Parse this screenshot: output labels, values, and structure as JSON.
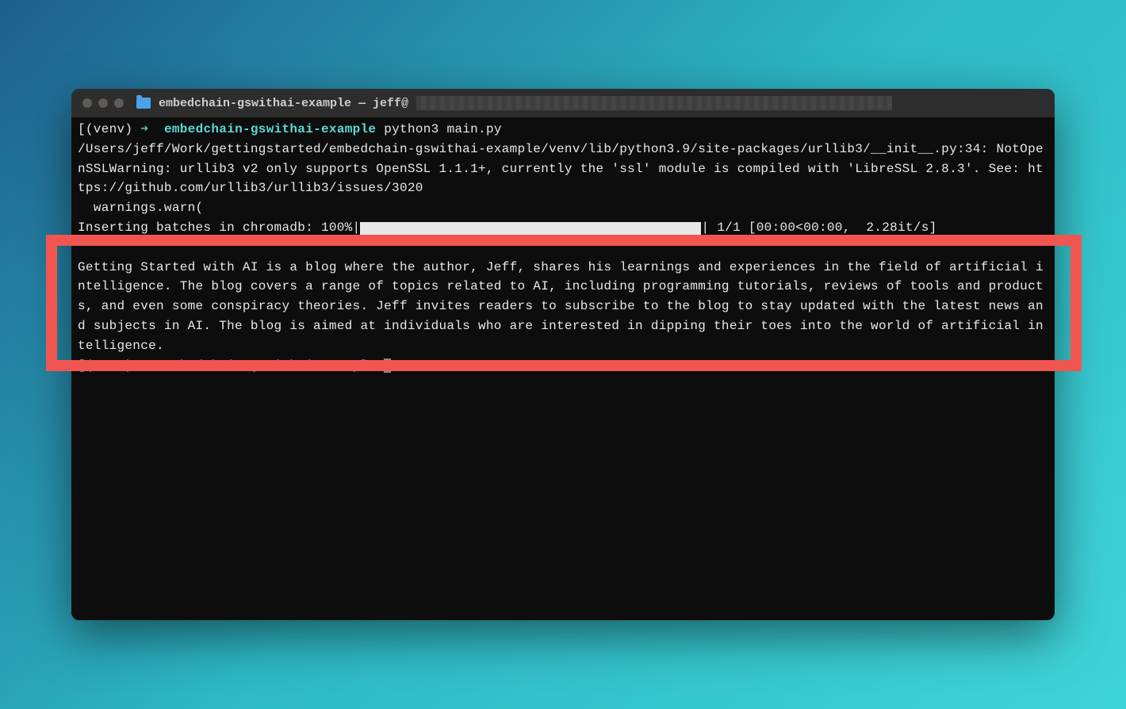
{
  "window": {
    "title": "embedchain-gswithai-example — jeff@"
  },
  "prompt1": {
    "venv": "(venv)",
    "arrow": "➜",
    "path": "embedchain-gswithai-example",
    "command": "python3 main.py"
  },
  "output": {
    "line1": "/Users/jeff/Work/gettingstarted/embedchain-gswithai-example/venv/lib/python3.9/site-packages/urllib3/__init__.py:34: NotOpenSSLWarning: urllib3 v2 only supports OpenSSL 1.1.1+, currently the 'ssl' module is compiled with 'LibreSSL 2.8.3'. See: https://github.com/urllib3/urllib3/issues/3020",
    "line2": "  warnings.warn(",
    "progress_prefix": "Inserting batches in chromadb: 100%|",
    "progress_suffix": "| 1/1 [00:00<00:00,  2.28it/s]",
    "answer": "Getting Started with AI is a blog where the author, Jeff, shares his learnings and experiences in the field of artificial intelligence. The blog covers a range of topics related to AI, including programming tutorials, reviews of tools and products, and even some conspiracy theories. Jeff invites readers to subscribe to the blog to stay updated with the latest news and subjects in AI. The blog is aimed at individuals who are interested in dipping their toes into the world of artificial intelligence."
  },
  "prompt2": {
    "venv": "(venv)",
    "arrow": "➜",
    "path": "embedchain-gswithai-example"
  }
}
